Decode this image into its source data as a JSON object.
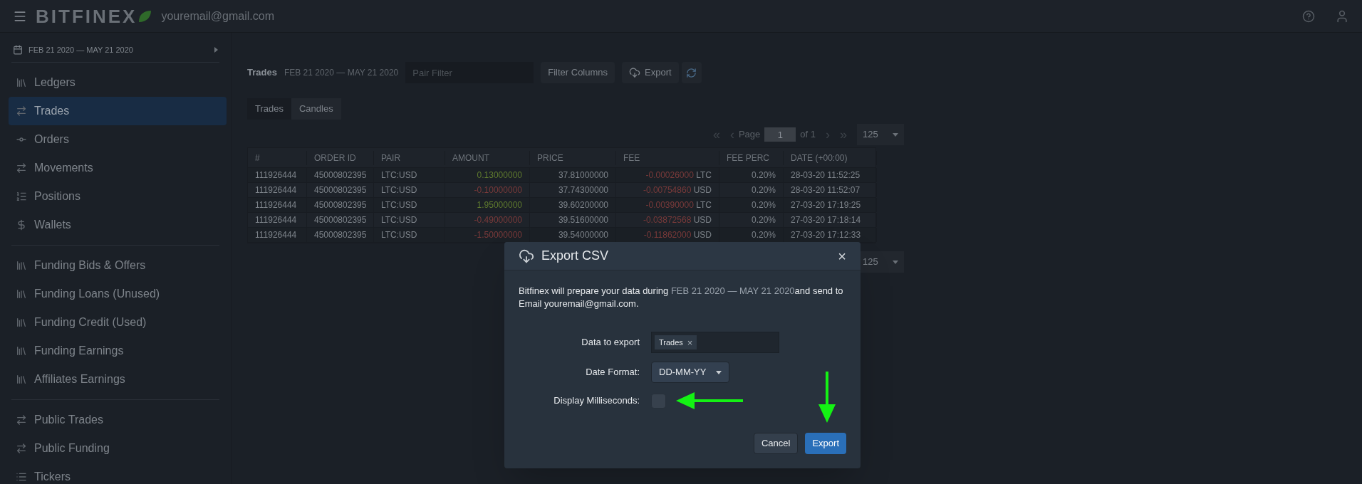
{
  "header": {
    "logo": "BITFINEX",
    "email": "youremail@gmail.com"
  },
  "sidebar": {
    "date_range": "FEB 21 2020 — MAY 21 2020",
    "groups": [
      [
        {
          "label": "Ledgers",
          "selected": false
        },
        {
          "label": "Trades",
          "selected": true
        },
        {
          "label": "Orders",
          "selected": false
        },
        {
          "label": "Movements",
          "selected": false
        },
        {
          "label": "Positions",
          "selected": false
        },
        {
          "label": "Wallets",
          "selected": false
        }
      ],
      [
        {
          "label": "Funding Bids & Offers",
          "selected": false
        },
        {
          "label": "Funding Loans (Unused)",
          "selected": false
        },
        {
          "label": "Funding Credit (Used)",
          "selected": false
        },
        {
          "label": "Funding Earnings",
          "selected": false
        },
        {
          "label": "Affiliates Earnings",
          "selected": false
        }
      ],
      [
        {
          "label": "Public Trades",
          "selected": false
        },
        {
          "label": "Public Funding",
          "selected": false
        },
        {
          "label": "Tickers",
          "selected": false
        }
      ]
    ]
  },
  "toolbar": {
    "title": "Trades",
    "date_range": "FEB 21 2020 — MAY 21 2020",
    "filter_placeholder": "Pair Filter",
    "filter_columns": "Filter Columns",
    "export": "Export"
  },
  "tabs": [
    {
      "label": "Trades",
      "selected": true
    },
    {
      "label": "Candles",
      "selected": false
    }
  ],
  "pagination": {
    "first": "«",
    "prev": "‹",
    "page_label": "Page",
    "page": "1",
    "of": "of 1",
    "next": "›",
    "last": "»",
    "page_size": "125"
  },
  "bottom_pagination": {
    "page_size": "125"
  },
  "table": {
    "columns": [
      "#",
      "ORDER ID",
      "PAIR",
      "AMOUNT",
      "PRICE",
      "FEE",
      "FEE PERC",
      "DATE (+00:00)"
    ],
    "rows": [
      {
        "id": "111926444",
        "order_id": "45000802395",
        "pair": "LTC:USD",
        "amount": "0.13000000",
        "color": "#5f7a2e",
        "price": "37.81000000",
        "fee": "-0.00026000",
        "fee_currency": "LTC",
        "fee_perc": "0.20%",
        "date": "28-03-20 11:52:25"
      },
      {
        "id": "111926444",
        "order_id": "45000802395",
        "pair": "LTC:USD",
        "amount": "-0.10000000",
        "color": "#7a3a3a",
        "price": "37.74300000",
        "fee": "-0.00754860",
        "fee_currency": "USD",
        "fee_perc": "0.20%",
        "date": "28-03-20 11:52:07"
      },
      {
        "id": "111926444",
        "order_id": "45000802395",
        "pair": "LTC:USD",
        "amount": "1.95000000",
        "color": "#5f7a2e",
        "price": "39.60200000",
        "fee": "-0.00390000",
        "fee_currency": "LTC",
        "fee_perc": "0.20%",
        "date": "27-03-20 17:19:25"
      },
      {
        "id": "111926444",
        "order_id": "45000802395",
        "pair": "LTC:USD",
        "amount": "-0.49000000",
        "color": "#7a3a3a",
        "price": "39.51600000",
        "fee": "-0.03872568",
        "fee_currency": "USD",
        "fee_perc": "0.20%",
        "date": "27-03-20 17:18:14"
      },
      {
        "id": "111926444",
        "order_id": "45000802395",
        "pair": "LTC:USD",
        "amount": "-1.50000000",
        "color": "#7a3a3a",
        "price": "39.54000000",
        "fee": "-0.11862000",
        "fee_currency": "USD",
        "fee_perc": "0.20%",
        "date": "27-03-20 17:12:33"
      }
    ]
  },
  "dialog": {
    "title": "Export CSV",
    "close": "×",
    "description": {
      "before": "Bitfinex will prepare your data during",
      "range": "FEB 21 2020 — MAY 21 2020",
      "after": "and send to Email youremail@gmail.com."
    },
    "data_label": "Data to export",
    "data_tags": [
      {
        "label": "Trades",
        "remove": "×"
      }
    ],
    "date_format_label": "Date Format:",
    "date_format": "DD-MM-YY",
    "milliseconds_label": "Display Milliseconds:",
    "milliseconds": false,
    "cancel": "Cancel",
    "export": "Export"
  }
}
